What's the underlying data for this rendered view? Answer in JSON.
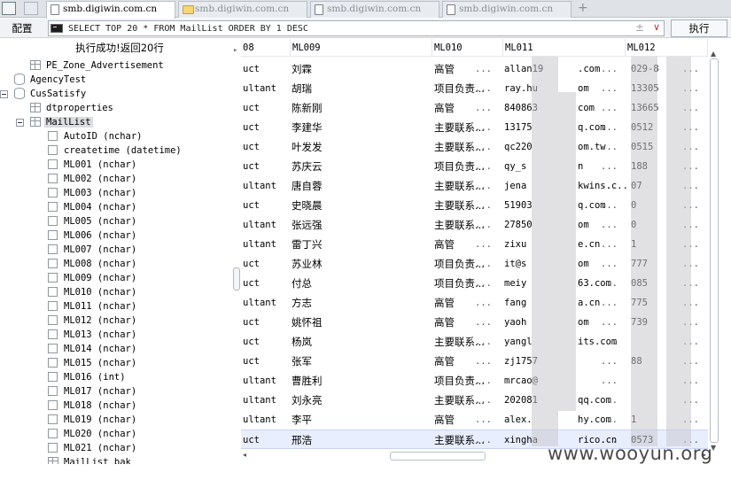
{
  "tabs": [
    {
      "label": "smb.digiwin.com.cn",
      "active": true,
      "icon": "document-icon"
    },
    {
      "label": "smb.digiwin.com.cn",
      "active": false,
      "icon": "folder-icon"
    },
    {
      "label": "smb.digiwin.com.cn",
      "active": false,
      "icon": "document-icon"
    },
    {
      "label": "smb.digiwin.com.cn",
      "active": false,
      "icon": "document-icon"
    }
  ],
  "new_tab_label": "+",
  "toolbar": {
    "config_label": "配置",
    "sql_value": "SELECT TOP 20 * FROM MailList ORDER BY 1 DESC",
    "adjust_label": "±",
    "dropdown_label": "∨",
    "run_label": "执行"
  },
  "status_text": "执行成功!返回20行",
  "tree": {
    "nodes": [
      {
        "label": "PE_Zone_Advertisement",
        "type": "table"
      },
      {
        "label": "AgencyTest",
        "type": "db"
      },
      {
        "label": "CusSatisfy",
        "type": "db"
      },
      {
        "label": "dtproperties",
        "type": "table"
      },
      {
        "label": "MailList",
        "type": "table"
      },
      {
        "label": "AutoID (nchar)",
        "type": "column"
      },
      {
        "label": "createtime (datetime)",
        "type": "column"
      },
      {
        "label": "ML001 (nchar)",
        "type": "column"
      },
      {
        "label": "ML002 (nchar)",
        "type": "column"
      },
      {
        "label": "ML003 (nchar)",
        "type": "column"
      },
      {
        "label": "ML004 (nchar)",
        "type": "column"
      },
      {
        "label": "ML005 (nchar)",
        "type": "column"
      },
      {
        "label": "ML006 (nchar)",
        "type": "column"
      },
      {
        "label": "ML007 (nchar)",
        "type": "column"
      },
      {
        "label": "ML008 (nchar)",
        "type": "column"
      },
      {
        "label": "ML009 (nchar)",
        "type": "column"
      },
      {
        "label": "ML010 (nchar)",
        "type": "column"
      },
      {
        "label": "ML011 (nchar)",
        "type": "column"
      },
      {
        "label": "ML012 (nchar)",
        "type": "column"
      },
      {
        "label": "ML013 (nchar)",
        "type": "column"
      },
      {
        "label": "ML014 (nchar)",
        "type": "column"
      },
      {
        "label": "ML015 (nchar)",
        "type": "column"
      },
      {
        "label": "ML016 (int)",
        "type": "column"
      },
      {
        "label": "ML017 (nchar)",
        "type": "column"
      },
      {
        "label": "ML018 (nchar)",
        "type": "column"
      },
      {
        "label": "ML019 (nchar)",
        "type": "column"
      },
      {
        "label": "ML020 (nchar)",
        "type": "column"
      },
      {
        "label": "ML021 (nchar)",
        "type": "column"
      },
      {
        "label": "MailList_bak",
        "type": "table"
      }
    ]
  },
  "grid": {
    "headers": [
      "08",
      "ML009",
      "ML010",
      "ML011",
      "ML012"
    ],
    "rows": [
      [
        "uct",
        "刘霖",
        "高管",
        "allan19",
        ".com",
        "029-8"
      ],
      [
        "ultant",
        "胡瑞",
        "项目负责...",
        "ray.hu",
        "om",
        "13305"
      ],
      [
        "uct",
        "陈新刚",
        "高管",
        "840863",
        "com",
        "13665"
      ],
      [
        "uct",
        "李建华",
        "主要联系...",
        "13175",
        "q.com",
        "0512"
      ],
      [
        "uct",
        "叶发发",
        "主要联系...",
        "qc220",
        "om.tw",
        "0515"
      ],
      [
        "uct",
        "苏庆云",
        "项目负责...",
        "qy_s",
        "n",
        "188"
      ],
      [
        "ultant",
        "唐自蓉",
        "主要联系...",
        "jena",
        "kwins.c...",
        "07"
      ],
      [
        "uct",
        "史晓晨",
        "主要联系...",
        "51903",
        "q.com",
        "0"
      ],
      [
        "ultant",
        "张远强",
        "主要联系...",
        "27850",
        "om",
        "0"
      ],
      [
        "ultant",
        "雷丁兴",
        "高管",
        "zixu",
        "e.cn",
        "1"
      ],
      [
        "uct",
        "苏业林",
        "项目负责...",
        "it@s",
        "om",
        "777"
      ],
      [
        "uct",
        "付总",
        "项目负责...",
        "meiy",
        "63.com",
        "085"
      ],
      [
        "ultant",
        "方志",
        "高管",
        "fang",
        "a.cn",
        "775"
      ],
      [
        "uct",
        "姚怀祖",
        "高管",
        "yaoh",
        "om",
        "739"
      ],
      [
        "uct",
        "杨岚",
        "主要联系...",
        "yangl",
        "its.com",
        ""
      ],
      [
        "uct",
        "张军",
        "高管",
        "zj1757",
        "",
        "88"
      ],
      [
        "ultant",
        "曹胜利",
        "项目负责...",
        "mrcao@",
        "",
        ""
      ],
      [
        "ultant",
        "刘永亮",
        "主要联系...",
        "202081",
        "qq.com",
        ""
      ],
      [
        "ultant",
        "李平",
        "高管",
        "alex.",
        "hy.com",
        "1"
      ],
      [
        "uct",
        "邢浩",
        "主要联系...",
        "xingha",
        "rico.cn",
        "0573"
      ]
    ],
    "ellipsis": "..."
  },
  "watermark": "www.wooyun.org"
}
